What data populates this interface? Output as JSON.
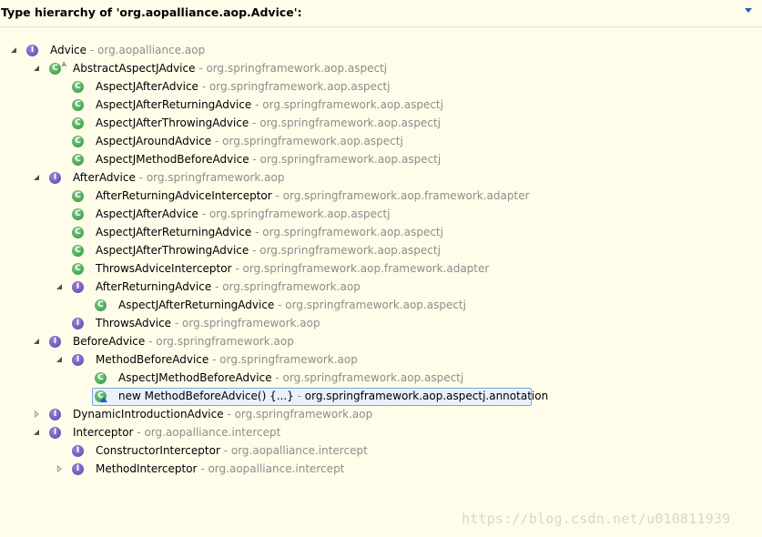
{
  "header": {
    "title": "Type hierarchy of 'org.aopalliance.aop.Advice':",
    "menu_icon": "chevron-down-icon"
  },
  "tree": [
    {
      "name": "Advice",
      "pkg": "org.aopalliance.aop",
      "kind": "interface",
      "state": "expanded"
    },
    {
      "name": "AbstractAspectJAdvice",
      "pkg": "org.springframework.aop.aspectj",
      "kind": "abstract-class",
      "state": "expanded"
    },
    {
      "name": "AspectJAfterAdvice",
      "pkg": "org.springframework.aop.aspectj",
      "kind": "class",
      "state": "leaf"
    },
    {
      "name": "AspectJAfterReturningAdvice",
      "pkg": "org.springframework.aop.aspectj",
      "kind": "class",
      "state": "leaf"
    },
    {
      "name": "AspectJAfterThrowingAdvice",
      "pkg": "org.springframework.aop.aspectj",
      "kind": "class",
      "state": "leaf"
    },
    {
      "name": "AspectJAroundAdvice",
      "pkg": "org.springframework.aop.aspectj",
      "kind": "class",
      "state": "leaf"
    },
    {
      "name": "AspectJMethodBeforeAdvice",
      "pkg": "org.springframework.aop.aspectj",
      "kind": "class",
      "state": "leaf"
    },
    {
      "name": "AfterAdvice",
      "pkg": "org.springframework.aop",
      "kind": "interface",
      "state": "expanded"
    },
    {
      "name": "AfterReturningAdviceInterceptor",
      "pkg": "org.springframework.aop.framework.adapter",
      "kind": "class",
      "state": "leaf"
    },
    {
      "name": "AspectJAfterAdvice",
      "pkg": "org.springframework.aop.aspectj",
      "kind": "class",
      "state": "leaf"
    },
    {
      "name": "AspectJAfterReturningAdvice",
      "pkg": "org.springframework.aop.aspectj",
      "kind": "class",
      "state": "leaf"
    },
    {
      "name": "AspectJAfterThrowingAdvice",
      "pkg": "org.springframework.aop.aspectj",
      "kind": "class",
      "state": "leaf"
    },
    {
      "name": "ThrowsAdviceInterceptor",
      "pkg": "org.springframework.aop.framework.adapter",
      "kind": "class",
      "state": "leaf"
    },
    {
      "name": "AfterReturningAdvice",
      "pkg": "org.springframework.aop",
      "kind": "interface",
      "state": "expanded"
    },
    {
      "name": "AspectJAfterReturningAdvice",
      "pkg": "org.springframework.aop.aspectj",
      "kind": "class",
      "state": "leaf"
    },
    {
      "name": "ThrowsAdvice",
      "pkg": "org.springframework.aop",
      "kind": "interface",
      "state": "leaf"
    },
    {
      "name": "BeforeAdvice",
      "pkg": "org.springframework.aop",
      "kind": "interface",
      "state": "expanded"
    },
    {
      "name": "MethodBeforeAdvice",
      "pkg": "org.springframework.aop",
      "kind": "interface",
      "state": "expanded"
    },
    {
      "name": "AspectJMethodBeforeAdvice",
      "pkg": "org.springframework.aop.aspectj",
      "kind": "class",
      "state": "leaf"
    },
    {
      "name": "new MethodBeforeAdvice() {...}",
      "pkg": "org.springframework.aop.aspectj.annotation",
      "kind": "anonymous-class",
      "state": "leaf",
      "selected": true
    },
    {
      "name": "DynamicIntroductionAdvice",
      "pkg": "org.springframework.aop",
      "kind": "interface",
      "state": "collapsed"
    },
    {
      "name": "Interceptor",
      "pkg": "org.aopalliance.intercept",
      "kind": "interface",
      "state": "expanded"
    },
    {
      "name": "ConstructorInterceptor",
      "pkg": "org.aopalliance.intercept",
      "kind": "interface",
      "state": "leaf"
    },
    {
      "name": "MethodInterceptor",
      "pkg": "org.aopalliance.intercept",
      "kind": "interface",
      "state": "collapsed"
    }
  ],
  "separator": " - ",
  "icon_letters": {
    "class": "C",
    "interface": "I",
    "abstract_marker": "A"
  },
  "watermark": "https://blog.csdn.net/u010811939",
  "colors": {
    "background": "#fffde9",
    "class_icon": "#2f8f3a",
    "interface_icon": "#5a3fa8",
    "package_text": "#8c8c8c",
    "selection_border": "#7aa6e3"
  }
}
